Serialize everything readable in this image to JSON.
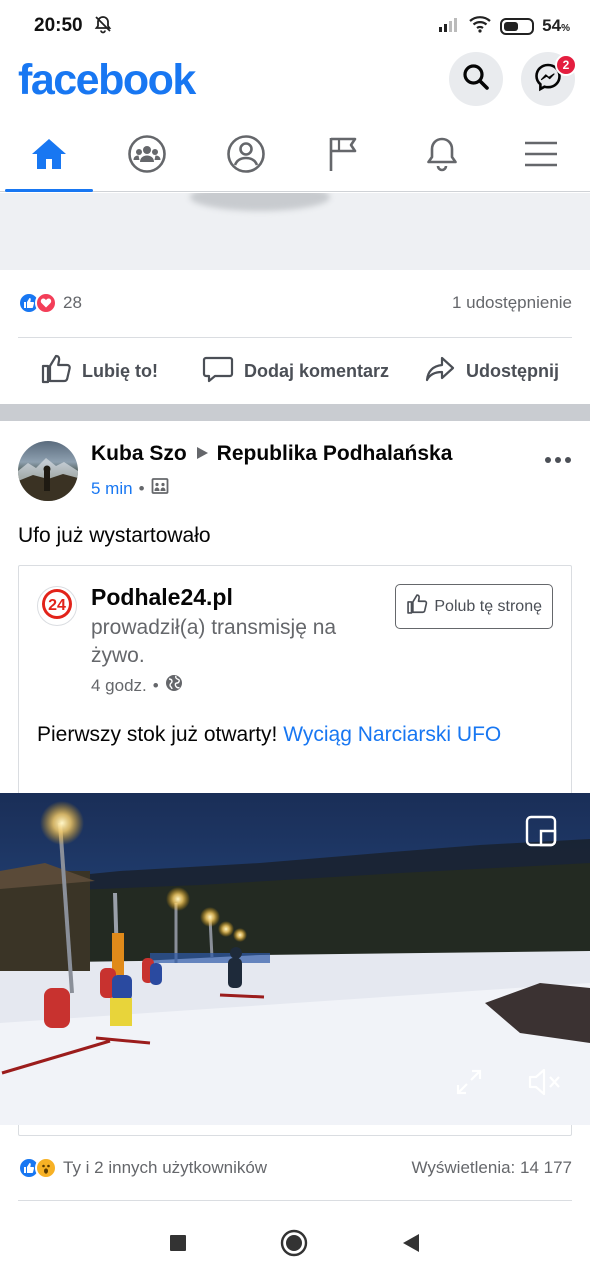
{
  "status_bar": {
    "time": "20:50",
    "battery": "54",
    "battery_unit": "%",
    "battery_level": 0.54
  },
  "header": {
    "logo_text": "facebook",
    "messenger_badge": "2",
    "brand_color": "#1877f2"
  },
  "tabs": [
    {
      "name": "home",
      "icon": "home-icon",
      "active": true
    },
    {
      "name": "groups",
      "icon": "groups-icon",
      "active": false
    },
    {
      "name": "profile",
      "icon": "profile-icon",
      "active": false
    },
    {
      "name": "pages",
      "icon": "flag-icon",
      "active": false
    },
    {
      "name": "notifications",
      "icon": "bell-icon",
      "active": false
    },
    {
      "name": "menu",
      "icon": "hamburger-icon",
      "active": false
    }
  ],
  "previous_post": {
    "reaction_count": "28",
    "shares": "1 udostępnienie",
    "actions": {
      "like": "Lubię to!",
      "comment": "Dodaj komentarz",
      "share": "Udostępnij"
    }
  },
  "post": {
    "author": "Kuba Szo",
    "group": "Republika Podhalańska",
    "time": "5 min",
    "text": "Ufo już wystartowało",
    "shared": {
      "page_name": "Podhale24.pl",
      "subtitle": "prowadził(a) transmisję na żywo.",
      "time": "4 godz.",
      "follow_label": "Polub tę stronę",
      "text_plain": "Pierwszy stok już otwarty! ",
      "text_link": "Wyciąg Narciarski UFO"
    },
    "reactions_text": "Ty i 2 innych użytkowników",
    "views": "Wyświetlenia: 14 177"
  }
}
